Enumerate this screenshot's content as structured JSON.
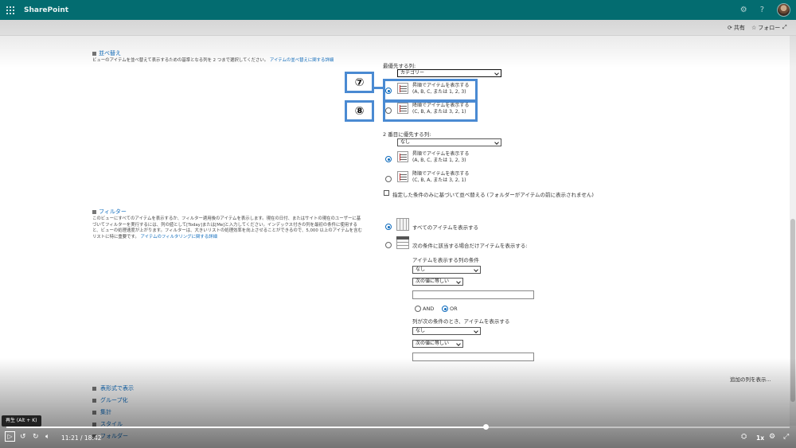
{
  "app": {
    "brand": "SharePoint"
  },
  "commandbar": {
    "share": "共有",
    "follow": "フォロー"
  },
  "sort": {
    "header": "並べ替え",
    "description": "ビューのアイテムを並べ替えて表示するための基準となる列を 2 つまで選択してください。",
    "learn_link": "アイテムの並べ替えに関する詳細",
    "primary_label": "最優先する列:",
    "primary_value": "カテゴリー",
    "primary_asc_line1": "昇順でアイテムを表示する",
    "primary_asc_line2": "(A, B, C, または 1, 2, 3)",
    "primary_desc_line1": "降順でアイテムを表示する",
    "primary_desc_line2": "(C, B, A, または 3, 2, 1)",
    "secondary_label": "2 番目に優先する列:",
    "secondary_value": "なし",
    "secondary_asc_line1": "昇順でアイテムを表示する",
    "secondary_asc_line2": "(A, B, C, または 1, 2, 3)",
    "secondary_desc_line1": "降順でアイテムを表示する",
    "secondary_desc_line2": "(C, B, A, または 3, 2, 1)",
    "only_condition": "指定した条件のみに基づいて並べ替える (フォルダーがアイテムの前に表示されません)"
  },
  "callouts": {
    "seven": "⑦",
    "eight": "⑧"
  },
  "filter": {
    "header": "フィルター",
    "description": "このビューにすべてのアイテムを表示するか、フィルター適用後のアイテムを表示します。現在の日付、またはサイトの現在のユーザーに基づいてフィルターを実行するには、列の値として[Today]または[Me]と入力してください。インデックス付きの列を最初の条件に使用すると、ビューの処理速度が上がります。フィルターは、大きいリストの処理効率を向上させることができるので、5,000 以上のアイテムを含むリストに特に重要です。",
    "learn_link": "アイテムのフィルタリングに関する詳細",
    "show_all": "すべてのアイテムを表示する",
    "show_conditional": "次の条件に該当する場合だけアイテムを表示する:",
    "cond1_label": "アイテムを表示する列の条件",
    "cond1_column": "なし",
    "cond1_operator": "次の値に等しい",
    "cond1_value": "",
    "and_label": "AND",
    "or_label": "OR",
    "cond2_label": "列が次の条件のとき、アイテムを表示する",
    "cond2_column": "なし",
    "cond2_operator": "次の値に等しい",
    "cond2_value": "",
    "more_columns": "追加の列を表示..."
  },
  "collapsed_sections": [
    "表形式で表示",
    "グループ化",
    "集計",
    "スタイル",
    "フォルダー"
  ],
  "player": {
    "tooltip": "再生 (Alt + K)",
    "time": "11:21 / 18:42",
    "speed": "1x",
    "progress": 0.612
  },
  "colors": {
    "suite_bar": "#036c70",
    "link": "#0f6cbd",
    "callout": "#4a8ad2"
  }
}
